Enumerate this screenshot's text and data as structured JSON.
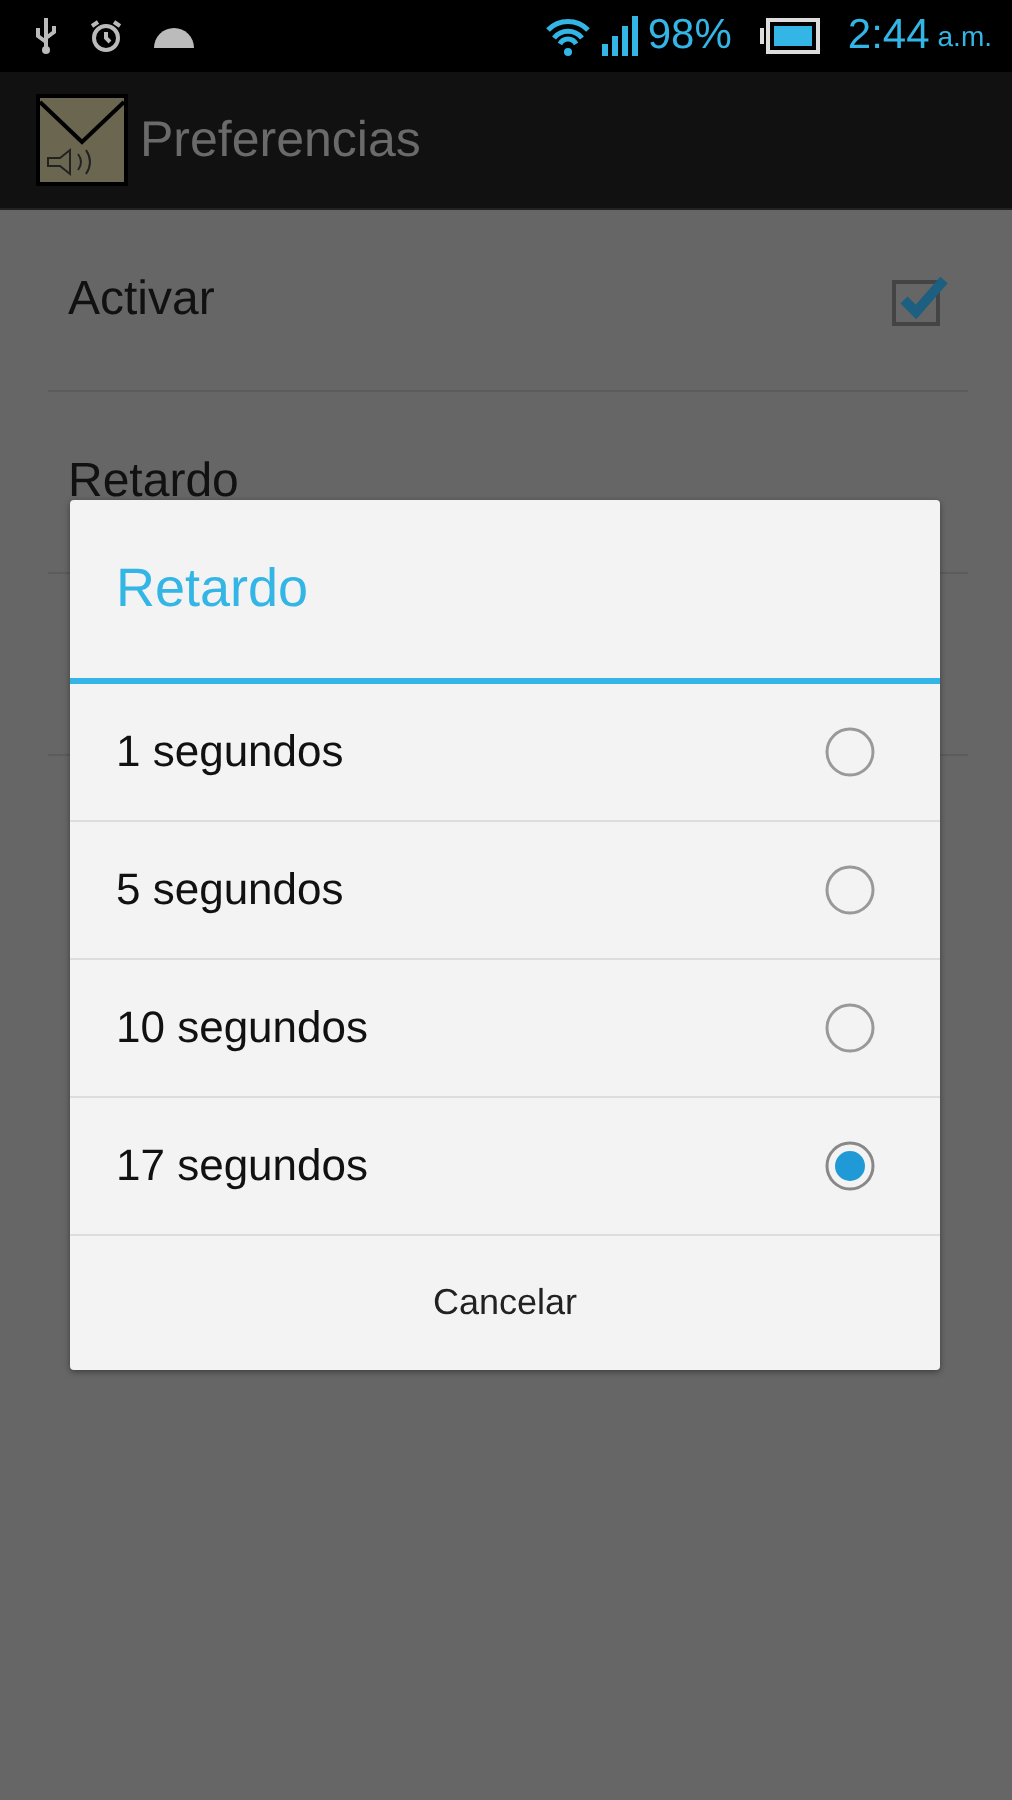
{
  "status_bar": {
    "battery": "98%",
    "time": "2:44",
    "ampm": "a.m."
  },
  "action_bar": {
    "title": "Preferencias"
  },
  "preferences": [
    {
      "kind": "checkbox",
      "label": "Activar",
      "checked": true
    },
    {
      "kind": "plain",
      "label": "Retardo"
    }
  ],
  "dialog": {
    "title": "Retardo",
    "options": [
      {
        "label": "1 segundos",
        "selected": false
      },
      {
        "label": "5 segundos",
        "selected": false
      },
      {
        "label": "10 segundos",
        "selected": false
      },
      {
        "label": "17 segundos",
        "selected": true
      }
    ],
    "button": "Cancelar"
  }
}
